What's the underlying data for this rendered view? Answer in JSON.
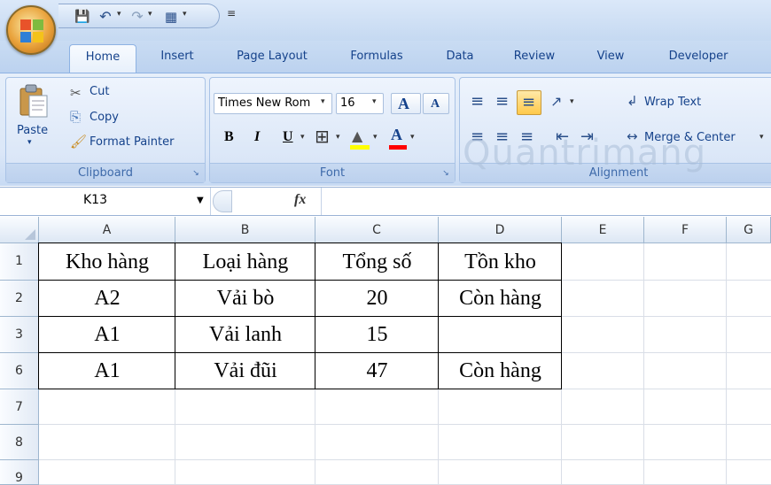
{
  "quick_access": {
    "icons": [
      "save-icon",
      "undo-icon",
      "redo-icon",
      "table-icon"
    ]
  },
  "tabs": [
    "Home",
    "Insert",
    "Page Layout",
    "Formulas",
    "Data",
    "Review",
    "View",
    "Developer"
  ],
  "clipboard": {
    "paste": "Paste",
    "cut": "Cut",
    "copy": "Copy",
    "format_painter": "Format Painter",
    "label": "Clipboard"
  },
  "font": {
    "name": "Times New Rom",
    "size": "16",
    "bold": "B",
    "italic": "I",
    "underline": "U",
    "grow": "A",
    "shrink": "A",
    "font_color": "A",
    "label": "Font"
  },
  "alignment": {
    "wrap_text": "Wrap Text",
    "merge_center": "Merge & Center",
    "label": "Alignment"
  },
  "formula_bar": {
    "name_box": "K13",
    "fx": "fx",
    "value": ""
  },
  "watermark": "Quantrimang",
  "columns": [
    "A",
    "B",
    "C",
    "D",
    "E",
    "F",
    "G"
  ],
  "rows": [
    {
      "num": "1",
      "cells": [
        "Kho hàng",
        "Loại hàng",
        "Tổng số",
        "Tồn kho",
        "",
        "",
        ""
      ]
    },
    {
      "num": "2",
      "cells": [
        "A2",
        "Vải bò",
        "20",
        "Còn hàng",
        "",
        "",
        ""
      ]
    },
    {
      "num": "3",
      "cells": [
        "A1",
        "Vải lanh",
        "15",
        "",
        "",
        "",
        ""
      ]
    },
    {
      "num": "6",
      "cells": [
        "A1",
        "Vải đũi",
        "47",
        "Còn hàng",
        "",
        "",
        ""
      ]
    },
    {
      "num": "7",
      "cells": [
        "",
        "",
        "",
        "",
        "",
        "",
        ""
      ]
    },
    {
      "num": "8",
      "cells": [
        "",
        "",
        "",
        "",
        "",
        "",
        ""
      ]
    },
    {
      "num": "9",
      "cells": [
        "",
        "",
        "",
        "",
        "",
        "",
        ""
      ]
    }
  ],
  "colors": {
    "ribbon_bg": "#dbe7f8",
    "accent": "#15428b",
    "highlight": "#ffd966"
  }
}
